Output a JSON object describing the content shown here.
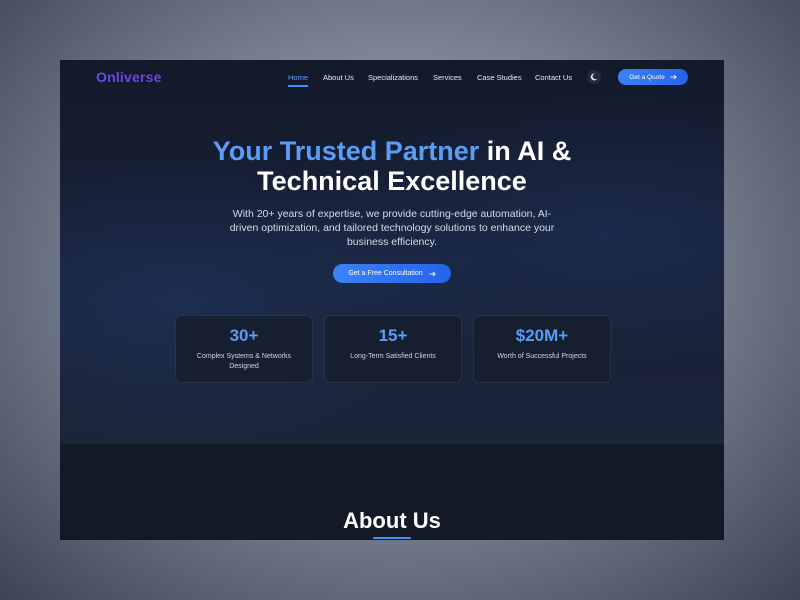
{
  "brand": {
    "logo_text": "Onliverse",
    "logo_first": "O",
    "logo_rest": "nliverse",
    "color": "#6d44e6"
  },
  "nav": {
    "items": [
      {
        "label": "Home",
        "active": true
      },
      {
        "label": "About Us"
      },
      {
        "label": "Specializations"
      },
      {
        "label": "Services"
      },
      {
        "label": "Case Studies"
      },
      {
        "label": "Contact Us"
      }
    ],
    "theme_toggle_icon": "moon-icon",
    "quote_button": {
      "label": "Get a Quote",
      "icon": "arrow-right-icon"
    }
  },
  "hero": {
    "headline_accent": "Your Trusted Partner",
    "headline_rest": " in AI &",
    "headline_line2": "Technical Excellence",
    "subtext": "With 20+ years of expertise, we provide cutting-edge automation, AI-driven optimization, and tailored technology solutions to enhance your business efficiency.",
    "cta": {
      "label": "Get a Free Consultation",
      "icon": "arrow-right-icon"
    }
  },
  "stats": [
    {
      "value": "30+",
      "label": "Complex Systems & Networks Designed"
    },
    {
      "value": "15+",
      "label": "Long-Term Satisfied Clients"
    },
    {
      "value": "$20M+",
      "label": "Worth of Successful Projects"
    }
  ],
  "about": {
    "title": "About Us"
  },
  "colors": {
    "accent": "#3b82f6",
    "accent_text": "#5b9cf5",
    "background": "#151b28"
  }
}
